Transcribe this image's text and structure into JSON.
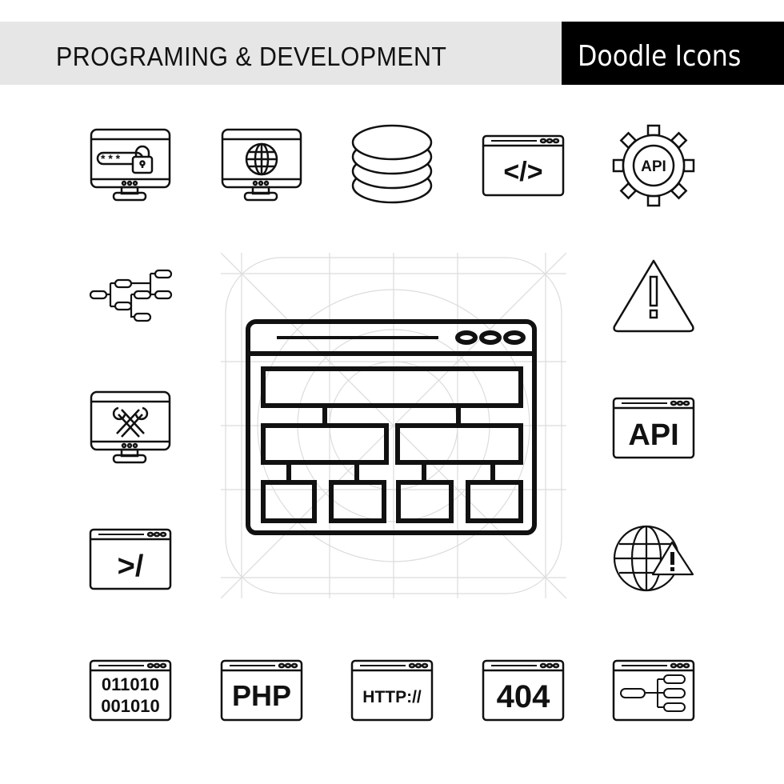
{
  "header": {
    "title": "PROGRAMING & DEVELOPMENT",
    "subtitle": "Doodle Icons",
    "title_band_color": "#e6e6e6",
    "subtitle_band_color": "#000000"
  },
  "icons": {
    "password_monitor": {
      "label": "password-monitor",
      "stars": "* * *"
    },
    "web_monitor": {
      "label": "web-monitor"
    },
    "database": {
      "label": "database"
    },
    "code_window": {
      "label": "code-window",
      "text": "</>"
    },
    "api_gear": {
      "label": "api-gear",
      "text": "API"
    },
    "hierarchy": {
      "label": "hierarchy"
    },
    "warning": {
      "label": "warning",
      "text": "!"
    },
    "tools_monitor": {
      "label": "tools-monitor"
    },
    "api_window": {
      "label": "api-window",
      "text": "API"
    },
    "terminal_window": {
      "label": "terminal-window",
      "text": ">/"
    },
    "globe_warning": {
      "label": "globe-warning",
      "text": "!"
    },
    "binary_window": {
      "label": "binary-window",
      "line1": "011010",
      "line2": "001010"
    },
    "php_window": {
      "label": "php-window",
      "text": "PHP"
    },
    "http_window": {
      "label": "http-window",
      "text": "HTTP://"
    },
    "error_404_window": {
      "label": "error-404-window",
      "text": "404"
    },
    "sitemap_window": {
      "label": "sitemap-window"
    },
    "featured_sitemap": {
      "label": "featured-sitemap-window"
    }
  }
}
